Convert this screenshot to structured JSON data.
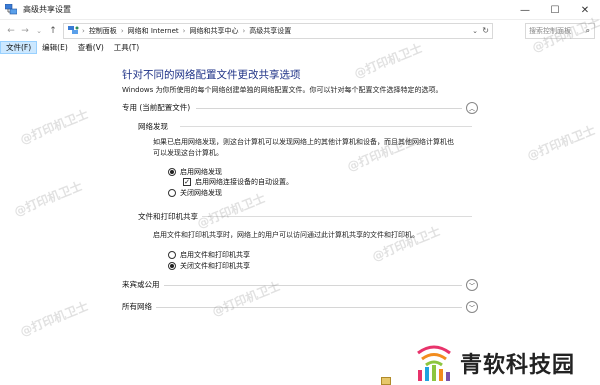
{
  "window": {
    "title": "高级共享设置",
    "min_label": "—",
    "max_label": "☐",
    "close_label": "✕"
  },
  "address": {
    "crumbs": [
      "控制面板",
      "网络和 Internet",
      "网络和共享中心",
      "高级共享设置"
    ],
    "separator": "›",
    "search_placeholder": "搜索控制面板"
  },
  "menu": {
    "items": [
      "文件(F)",
      "编辑(E)",
      "查看(V)",
      "工具(T)"
    ]
  },
  "page": {
    "heading": "针对不同的网络配置文件更改共享选项",
    "description": "Windows 为你所使用的每个网络创建单独的网络配置文件。你可以针对每个配置文件选择特定的选项。"
  },
  "private_profile": {
    "label": "专用 (当前配置文件)",
    "network_discovery": {
      "title": "网络发现",
      "text_line1": "如果已启用网络发现，则这台计算机可以发现网络上的其他计算机和设备，而且其他网络计算机也",
      "text_line2": "可以发现这台计算机。",
      "option_on": "启用网络发现",
      "option_auto": "启用网络连接设备的自动设置。",
      "option_off": "关闭网络发现",
      "selected": "on",
      "auto_checked": true
    },
    "file_printer_sharing": {
      "title": "文件和打印机共享",
      "text": "启用文件和打印机共享时，网络上的用户可以访问通过此计算机共享的文件和打印机。",
      "option_on": "启用文件和打印机共享",
      "option_off": "关闭文件和打印机共享",
      "selected": "off"
    }
  },
  "guest_profile": {
    "label": "来宾或公用"
  },
  "all_networks": {
    "label": "所有网络"
  },
  "watermark": {
    "text": "@打印机卫士"
  },
  "logo": {
    "text": "青软科技园"
  },
  "colors": {
    "heading": "#1e3287",
    "menu_active": "#cce8ff"
  }
}
